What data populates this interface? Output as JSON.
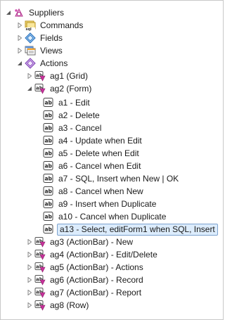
{
  "tree": {
    "root": {
      "label": "Suppliers",
      "icon": "controller-icon"
    },
    "top_nodes": {
      "commands": {
        "label": "Commands",
        "icon": "sql-commands-icon"
      },
      "fields": {
        "label": "Fields",
        "icon": "fields-icon"
      },
      "views": {
        "label": "Views",
        "icon": "views-icon"
      },
      "actions": {
        "label": "Actions",
        "icon": "actions-icon"
      }
    },
    "groups": {
      "ag1": {
        "label": "ag1 (Grid)",
        "icon": "action-group-icon"
      },
      "ag2": {
        "label": "ag2 (Form)",
        "icon": "action-group-icon"
      },
      "ag3": {
        "label": "ag3 (ActionBar) - New",
        "icon": "action-group-icon"
      },
      "ag4": {
        "label": "ag4 (ActionBar) - Edit/Delete",
        "icon": "action-group-icon"
      },
      "ag5": {
        "label": "ag5 (ActionBar) - Actions",
        "icon": "action-group-icon"
      },
      "ag6": {
        "label": "ag6 (ActionBar) - Record",
        "icon": "action-group-icon"
      },
      "ag7": {
        "label": "ag7 (ActionBar) - Report",
        "icon": "action-group-icon"
      },
      "ag8": {
        "label": "ag8 (Row)",
        "icon": "action-group-icon"
      }
    },
    "ag2_actions": [
      {
        "label": "a1 - Edit",
        "icon": "action-ab-icon"
      },
      {
        "label": "a2 - Delete",
        "icon": "action-ab-icon"
      },
      {
        "label": "a3 - Cancel",
        "icon": "action-ab-icon"
      },
      {
        "label": "a4 - Update when Edit",
        "icon": "action-ab-icon"
      },
      {
        "label": "a5 - Delete when Edit",
        "icon": "action-ab-icon"
      },
      {
        "label": "a6 - Cancel when Edit",
        "icon": "action-ab-icon"
      },
      {
        "label": "a7 - SQL, Insert when New | OK",
        "icon": "action-ab-icon"
      },
      {
        "label": "a8 - Cancel when New",
        "icon": "action-ab-icon"
      },
      {
        "label": "a9 - Insert when Duplicate",
        "icon": "action-ab-icon"
      },
      {
        "label": "a10 - Cancel when Duplicate",
        "icon": "action-ab-icon"
      },
      {
        "label": "a13 - Select, editForm1 when SQL, Insert",
        "icon": "action-ab-icon",
        "selected": true
      }
    ],
    "colors": {
      "selection_bg": "#dcecfc",
      "selection_border": "#7da2ce",
      "group_icon_magenta": "#c8329b",
      "actions_icon_purple": "#8b4fc2"
    }
  }
}
